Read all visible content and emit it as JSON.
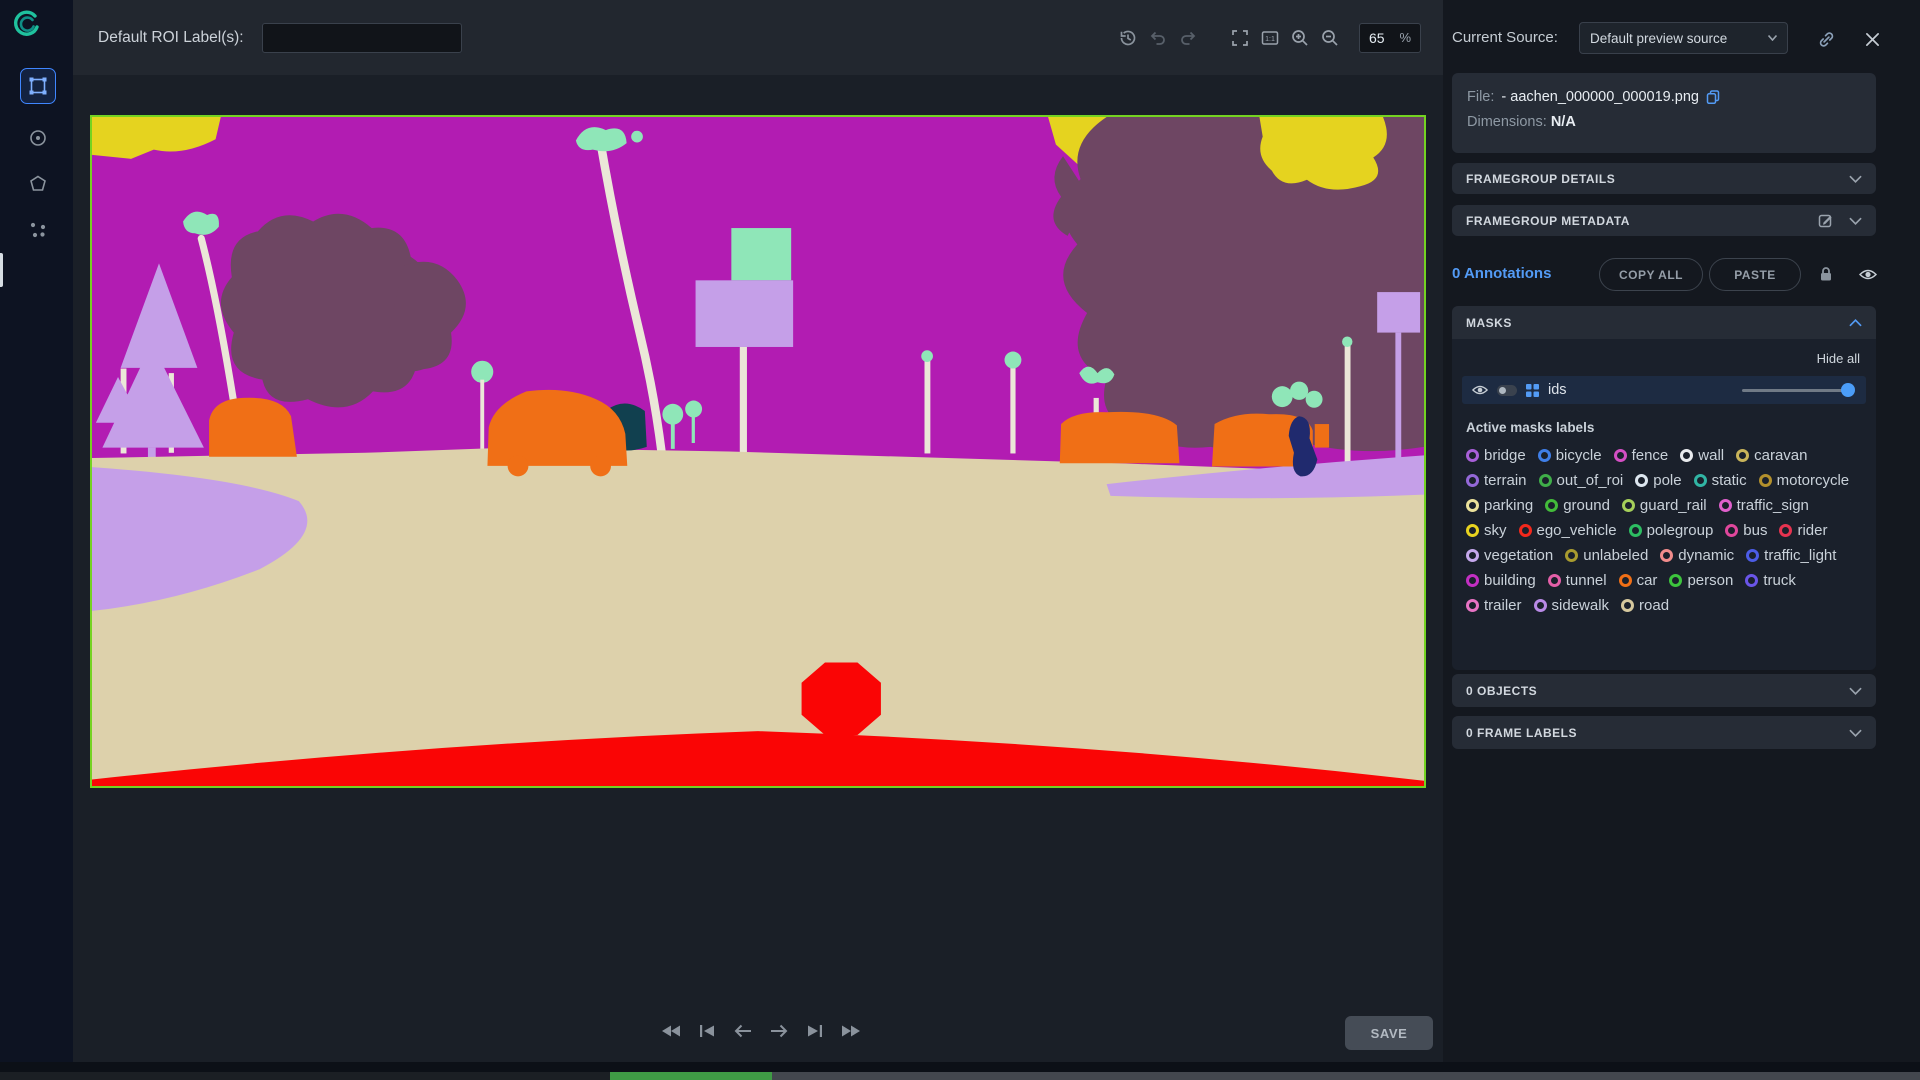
{
  "toolbar": {
    "roi_label": "Default ROI Label(s):",
    "roi_input_value": "",
    "zoom_value": "65",
    "zoom_percent": "%"
  },
  "right_panel": {
    "current_source_label": "Current Source:",
    "source_value": "Default preview source",
    "file_label": "File:",
    "file_name": "- aachen_000000_000019.png",
    "dimensions_label": "Dimensions:",
    "dimensions_value": "N/A",
    "framegroup_details": "FRAMEGROUP DETAILS",
    "framegroup_metadata": "FRAMEGROUP METADATA",
    "annotations_count": "0 Annotations",
    "copy_all": "COPY ALL",
    "paste": "PASTE",
    "masks": {
      "title": "MASKS",
      "hide_all": "Hide all",
      "layer_name": "ids",
      "active_labels_title": "Active masks labels",
      "labels": [
        {
          "name": "bridge",
          "color": "#a85fd8"
        },
        {
          "name": "bicycle",
          "color": "#3f7fe8"
        },
        {
          "name": "fence",
          "color": "#d44fc4"
        },
        {
          "name": "wall",
          "color": "#e8eaed"
        },
        {
          "name": "caravan",
          "color": "#c9b45a"
        },
        {
          "name": "terrain",
          "color": "#9468d8"
        },
        {
          "name": "out_of_roi",
          "color": "#3fae49"
        },
        {
          "name": "pole",
          "color": "#dde6ef"
        },
        {
          "name": "static",
          "color": "#31b5a4"
        },
        {
          "name": "motorcycle",
          "color": "#b3902c"
        },
        {
          "name": "parking",
          "color": "#ece29b"
        },
        {
          "name": "ground",
          "color": "#43bb3a"
        },
        {
          "name": "guard_rail",
          "color": "#a5cf5a"
        },
        {
          "name": "traffic_sign",
          "color": "#e060cc"
        },
        {
          "name": "sky",
          "color": "#e8d31f"
        },
        {
          "name": "ego_vehicle",
          "color": "#f3281c"
        },
        {
          "name": "polegroup",
          "color": "#2dbd62"
        },
        {
          "name": "bus",
          "color": "#e0479c"
        },
        {
          "name": "rider",
          "color": "#e63350"
        },
        {
          "name": "vegetation",
          "color": "#c5a8ec"
        },
        {
          "name": "unlabeled",
          "color": "#a89b2f"
        },
        {
          "name": "dynamic",
          "color": "#f28c8c"
        },
        {
          "name": "traffic_light",
          "color": "#4c5ce6"
        },
        {
          "name": "building",
          "color": "#c32fc3"
        },
        {
          "name": "tunnel",
          "color": "#e45fa8"
        },
        {
          "name": "car",
          "color": "#f06f16"
        },
        {
          "name": "person",
          "color": "#3dc43d"
        },
        {
          "name": "truck",
          "color": "#6a55e8"
        },
        {
          "name": "trailer",
          "color": "#e873c4"
        },
        {
          "name": "sidewalk",
          "color": "#b98ae6"
        },
        {
          "name": "road",
          "color": "#d6c89e"
        }
      ]
    },
    "objects_header": "0 OBJECTS",
    "frame_labels_header": "0 FRAME LABELS"
  },
  "bottom_bar": {
    "save": "SAVE"
  },
  "colors": {
    "accent_blue": "#539bf5",
    "image_border": "#74d321",
    "selected_tool": "#3f86ff"
  }
}
